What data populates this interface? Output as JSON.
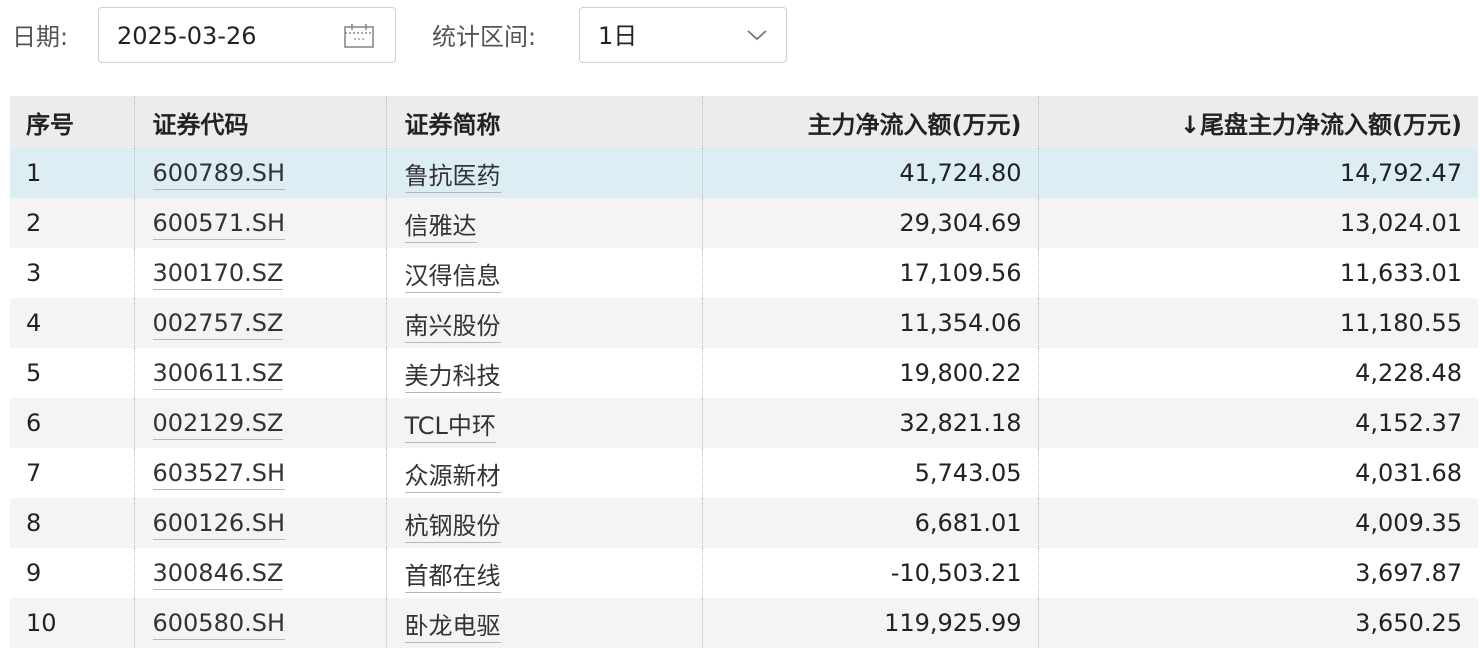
{
  "filters": {
    "date_label": "日期:",
    "date_value": "2025-03-26",
    "range_label": "统计区间:",
    "range_value": "1日"
  },
  "table": {
    "headers": [
      "序号",
      "证券代码",
      "证券简称",
      "主力净流入额(万元)",
      "↓尾盘主力净流入额(万元)"
    ],
    "rows": [
      {
        "index": "1",
        "code": "600789.SH",
        "name": "鲁抗医药",
        "net_inflow": "41,724.80",
        "close_inflow": "14,792.47"
      },
      {
        "index": "2",
        "code": "600571.SH",
        "name": "信雅达",
        "net_inflow": "29,304.69",
        "close_inflow": "13,024.01"
      },
      {
        "index": "3",
        "code": "300170.SZ",
        "name": "汉得信息",
        "net_inflow": "17,109.56",
        "close_inflow": "11,633.01"
      },
      {
        "index": "4",
        "code": "002757.SZ",
        "name": "南兴股份",
        "net_inflow": "11,354.06",
        "close_inflow": "11,180.55"
      },
      {
        "index": "5",
        "code": "300611.SZ",
        "name": "美力科技",
        "net_inflow": "19,800.22",
        "close_inflow": "4,228.48"
      },
      {
        "index": "6",
        "code": "002129.SZ",
        "name": "TCL中环",
        "net_inflow": "32,821.18",
        "close_inflow": "4,152.37"
      },
      {
        "index": "7",
        "code": "603527.SH",
        "name": "众源新材",
        "net_inflow": "5,743.05",
        "close_inflow": "4,031.68"
      },
      {
        "index": "8",
        "code": "600126.SH",
        "name": "杭钢股份",
        "net_inflow": "6,681.01",
        "close_inflow": "4,009.35"
      },
      {
        "index": "9",
        "code": "300846.SZ",
        "name": "首都在线",
        "net_inflow": "-10,503.21",
        "close_inflow": "3,697.87"
      },
      {
        "index": "10",
        "code": "600580.SH",
        "name": "卧龙电驱",
        "net_inflow": "119,925.99",
        "close_inflow": "3,650.25"
      }
    ]
  },
  "icons": {
    "date_picker": "calendar-icon",
    "range_select": "chevron-down-icon"
  },
  "colors": {
    "header_bg": "#ececec",
    "selected_row_bg": "#dcedf3",
    "alt_row_bg": "#f4f4f4"
  }
}
